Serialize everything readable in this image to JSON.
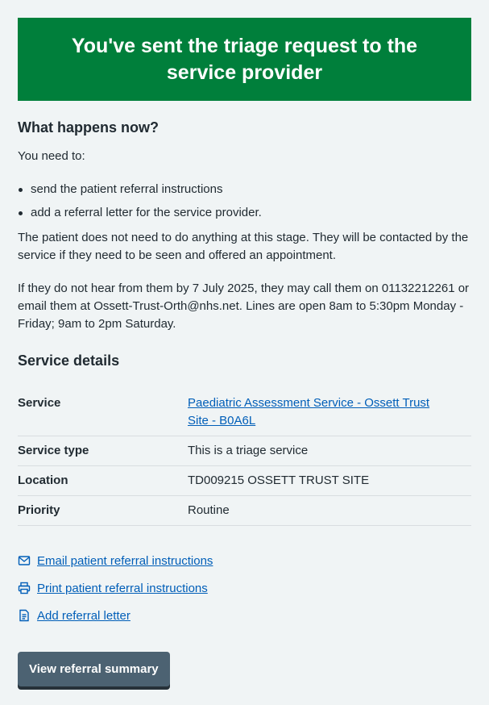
{
  "panel": {
    "title": "You've sent the triage request to the service provider"
  },
  "what_happens": {
    "heading": "What happens now?",
    "intro": "You need to:",
    "bullets": [
      "send the patient referral instructions",
      "add a referral letter for the service provider."
    ],
    "patient_paragraph": "The patient does not need to do anything at this stage. They will be contacted by the service if they need to be seen and offered an appointment.",
    "contact_paragraph": "If they do not hear from them by 7 July 2025, they may call them on 01132212261 or email them at Ossett-Trust-Orth@nhs.net. Lines are open 8am to 5:30pm Monday - Friday; 9am to 2pm Saturday."
  },
  "service_details": {
    "heading": "Service details",
    "rows": [
      {
        "key": "Service",
        "value": "Paediatric Assessment Service - Ossett Trust Site - B0A6L"
      },
      {
        "key": "Service type",
        "value": "This is a triage service"
      },
      {
        "key": "Location",
        "value": "TD009215 OSSETT TRUST SITE"
      },
      {
        "key": "Priority",
        "value": "Routine"
      }
    ]
  },
  "actions": [
    {
      "label": "Email patient referral instructions",
      "icon": "envelope-icon"
    },
    {
      "label": "Print patient referral instructions",
      "icon": "printer-icon"
    },
    {
      "label": "Add referral letter",
      "icon": "document-icon"
    }
  ],
  "button": {
    "label": "View referral summary"
  },
  "colors": {
    "panel_green": "#007f3b",
    "link_blue": "#005eb8",
    "button_grey": "#4c6272",
    "background": "#f0f4f5"
  }
}
